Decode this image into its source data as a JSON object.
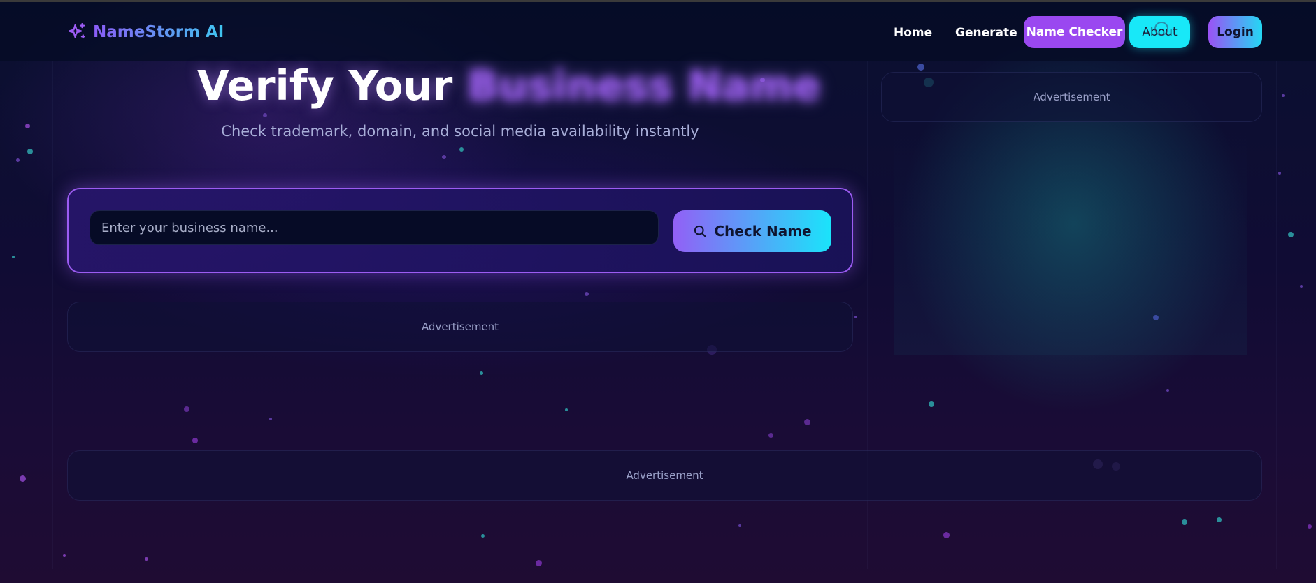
{
  "brand": {
    "name": "NameStorm AI",
    "icon": "sparkle-icon",
    "gradient": [
      "#8b5cf6",
      "#3fc6f0"
    ]
  },
  "nav": {
    "home": "Home",
    "generate": "Generate",
    "name_checker": "Name Checker",
    "about": "About",
    "login": "Login"
  },
  "hero": {
    "title_prefix": "Verify Your",
    "title_highlight": "Business Name",
    "subtitle": "Check trademark, domain, and social media availability instantly"
  },
  "search": {
    "placeholder": "Enter your business name...",
    "value": "",
    "button_label": "Check Name",
    "button_icon": "search-icon"
  },
  "ads": {
    "right": "Advertisement",
    "left": "Advertisement",
    "bottom": "Advertisement"
  },
  "colors": {
    "accent_purple": "#9a48f0",
    "accent_cyan": "#18e8f8",
    "background": "#0b0c26"
  }
}
